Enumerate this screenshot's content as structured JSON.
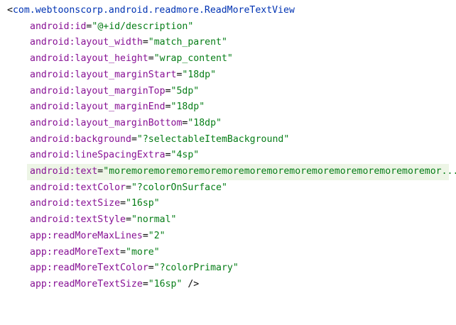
{
  "colors": {
    "tag": "#0033b3",
    "attribute": "#871094",
    "value": "#067d17",
    "highlight": "#edf5e6"
  },
  "tag": {
    "open": "<",
    "name": "com.webtoonscorp.android.readmore.ReadMoreTextView"
  },
  "attributes": [
    {
      "ns": "android",
      "name": "id",
      "value": "\"@+id/description\""
    },
    {
      "ns": "android",
      "name": "layout_width",
      "value": "\"match_parent\""
    },
    {
      "ns": "android",
      "name": "layout_height",
      "value": "\"wrap_content\""
    },
    {
      "ns": "android",
      "name": "layout_marginStart",
      "value": "\"18dp\""
    },
    {
      "ns": "android",
      "name": "layout_marginTop",
      "value": "\"5dp\""
    },
    {
      "ns": "android",
      "name": "layout_marginEnd",
      "value": "\"18dp\""
    },
    {
      "ns": "android",
      "name": "layout_marginBottom",
      "value": "\"18dp\""
    },
    {
      "ns": "android",
      "name": "background",
      "value": "\"?selectableItemBackground\""
    },
    {
      "ns": "android",
      "name": "lineSpacingExtra",
      "value": "\"4sp\""
    },
    {
      "ns": "android",
      "name": "text",
      "value": "\"moremoremoremoremoremoremoremoremoremoremoremoremoremoremor...\""
    },
    {
      "ns": "android",
      "name": "textColor",
      "value": "\"?colorOnSurface\""
    },
    {
      "ns": "android",
      "name": "textSize",
      "value": "\"16sp\""
    },
    {
      "ns": "android",
      "name": "textStyle",
      "value": "\"normal\""
    },
    {
      "ns": "app",
      "name": "readMoreMaxLines",
      "value": "\"2\""
    },
    {
      "ns": "app",
      "name": "readMoreText",
      "value": "\"more\""
    },
    {
      "ns": "app",
      "name": "readMoreTextColor",
      "value": "\"?colorPrimary\""
    },
    {
      "ns": "app",
      "name": "readMoreTextSize",
      "value": "\"16sp\""
    }
  ],
  "closing": " />"
}
